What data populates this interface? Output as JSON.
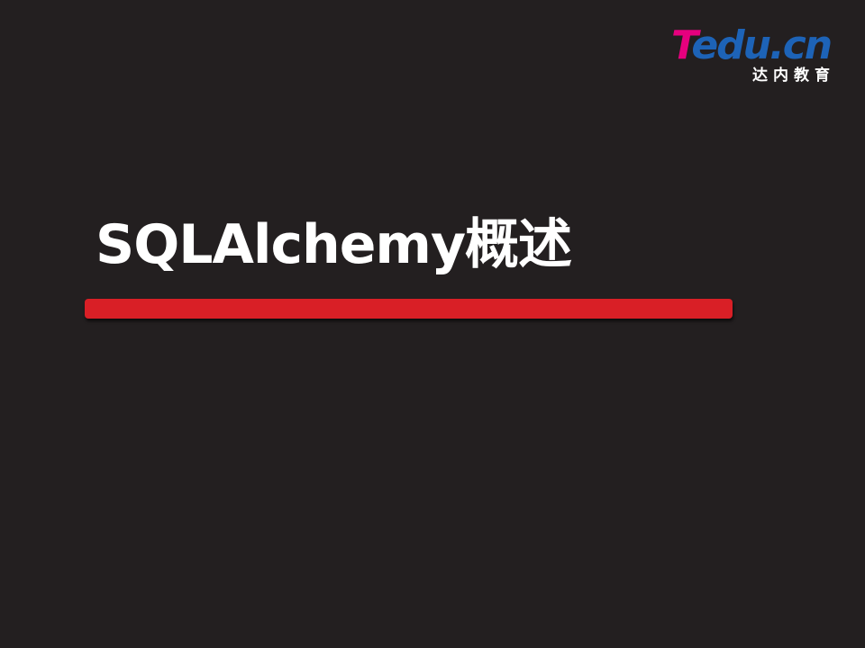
{
  "logo": {
    "wordmark_first": "T",
    "wordmark_rest": "edu.cn",
    "subtitle": "达内教育",
    "colors": {
      "pink": "#e6007e",
      "blue": "#1d63b7"
    }
  },
  "slide": {
    "title": "SQLAlchemy概述",
    "background": "#231f20",
    "bar_color": "#d91f26"
  }
}
